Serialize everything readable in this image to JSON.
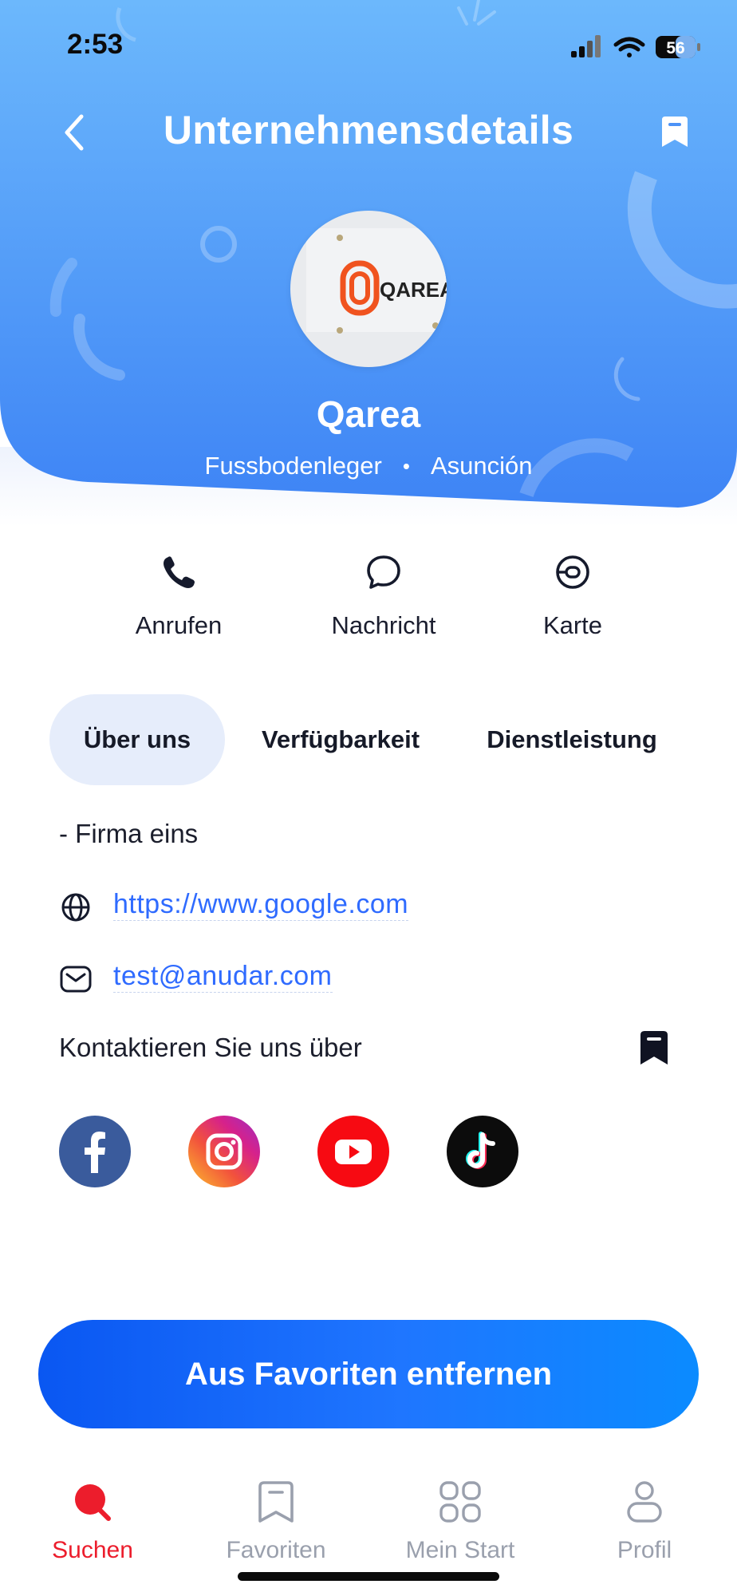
{
  "status_bar": {
    "time": "2:53",
    "battery": "56"
  },
  "header": {
    "title": "Unternehmensdetails"
  },
  "company": {
    "logo_text": "QAREA",
    "name": "Qarea",
    "category": "Fussbodenleger",
    "separator": "•",
    "city": "Asunción"
  },
  "actions": [
    {
      "label": "Anrufen",
      "icon": "phone-icon"
    },
    {
      "label": "Nachricht",
      "icon": "chat-bubble-icon"
    },
    {
      "label": "Karte",
      "icon": "map-pin-icon"
    }
  ],
  "tabs": [
    {
      "label": "Über uns",
      "active": true
    },
    {
      "label": "Verfügbarkeit",
      "active": false
    },
    {
      "label": "Dienstleistung",
      "active": false
    }
  ],
  "about": {
    "description": "- Firma eins",
    "website": "https://www.google.com",
    "email": "test@anudar.com"
  },
  "contact": {
    "label": "Kontaktieren Sie uns über",
    "socials": [
      "facebook",
      "instagram",
      "youtube",
      "tiktok"
    ]
  },
  "cta": {
    "label": "Aus Favoriten entfernen"
  },
  "bottom_nav": [
    {
      "label": "Suchen",
      "icon": "search-icon",
      "active": true
    },
    {
      "label": "Favoriten",
      "icon": "bookmark-icon",
      "active": false
    },
    {
      "label": "Mein Start",
      "icon": "grid-icon",
      "active": false
    },
    {
      "label": "Profil",
      "icon": "user-icon",
      "active": false
    }
  ],
  "colors": {
    "header_gradient_top": "#6ab4fb",
    "header_gradient_bottom": "#3f86f6",
    "accent_blue": "#2f6bff",
    "active_red": "#ec1d2c"
  }
}
